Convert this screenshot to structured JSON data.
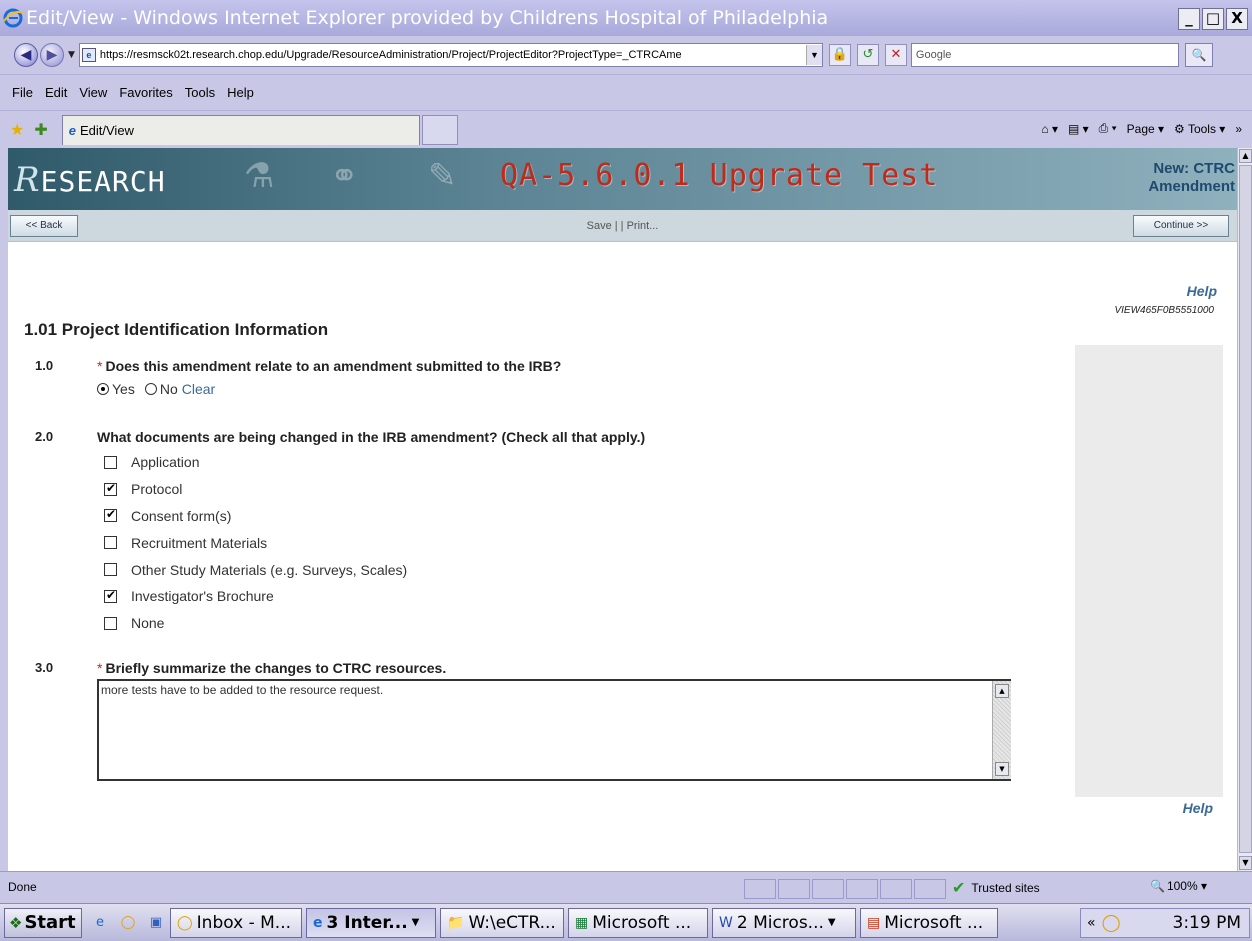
{
  "window": {
    "title": "Edit/View - Windows Internet Explorer provided by Childrens Hospital of Philadelphia",
    "controls": [
      "_",
      "□",
      "X"
    ]
  },
  "address": {
    "url": "https://resmsck02t.research.chop.edu/Upgrade/ResourceAdministration/Project/ProjectEditor?ProjectType=_CTRCAme",
    "search_placeholder": "Google"
  },
  "menu": [
    "File",
    "Edit",
    "View",
    "Favorites",
    "Tools",
    "Help"
  ],
  "tabs": [
    {
      "label": "Edit/View"
    }
  ],
  "commandbar": {
    "page": "Page",
    "tools": "Tools"
  },
  "banner": {
    "logo": "ESEARCH",
    "logo_r": "R",
    "env_title": "QA-5.6.0.1 Upgrate Test",
    "new_label_line1": "New: CTRC",
    "new_label_line2": "Amendment"
  },
  "actions": {
    "back": "<< Back",
    "save_print": "Save | | Print...",
    "continue": "Continue >>"
  },
  "help": {
    "label": "Help",
    "view_id": "VIEW465F0B5551000"
  },
  "form": {
    "section_title": "1.01 Project Identification Information",
    "questions": [
      {
        "number": "1.0",
        "required": "*",
        "text": "Does this amendment relate to an amendment submitted to the IRB?",
        "options": [
          "Yes",
          "No"
        ],
        "selected": "Yes",
        "clear_label": "Clear"
      },
      {
        "number": "2.0",
        "text": "What documents are being changed in the IRB amendment?  (Check all that apply.)",
        "checkboxes": [
          {
            "label": "Application",
            "checked": false
          },
          {
            "label": "Protocol",
            "checked": true
          },
          {
            "label": "Consent form(s)",
            "checked": true
          },
          {
            "label": "Recruitment Materials",
            "checked": false
          },
          {
            "label": "Other Study Materials (e.g. Surveys, Scales)",
            "checked": false
          },
          {
            "label": "Investigator's Brochure",
            "checked": true
          },
          {
            "label": "None",
            "checked": false
          }
        ]
      },
      {
        "number": "3.0",
        "required": "*",
        "text": "Briefly summarize the changes to CTRC resources.",
        "value": "more tests have to be added to the resource request."
      }
    ]
  },
  "status": {
    "text": "Done",
    "zone": "Trusted sites",
    "zoom": "100%"
  },
  "taskbar": {
    "start": "Start",
    "tasks": [
      {
        "label": "Inbox - M...",
        "icon": "outlook-icon",
        "active": false
      },
      {
        "label": "3 Inter...",
        "icon": "ie-icon",
        "active": true
      },
      {
        "label": "W:\\eCTR...",
        "icon": "folder-icon",
        "active": false
      },
      {
        "label": "Microsoft ...",
        "icon": "excel-icon",
        "active": false
      },
      {
        "label": "2 Micros...",
        "icon": "word-icon",
        "active": false
      },
      {
        "label": "Microsoft ...",
        "icon": "powerpoint-icon",
        "active": false
      }
    ],
    "tray_chevron": "«",
    "clock": "3:19 PM"
  }
}
